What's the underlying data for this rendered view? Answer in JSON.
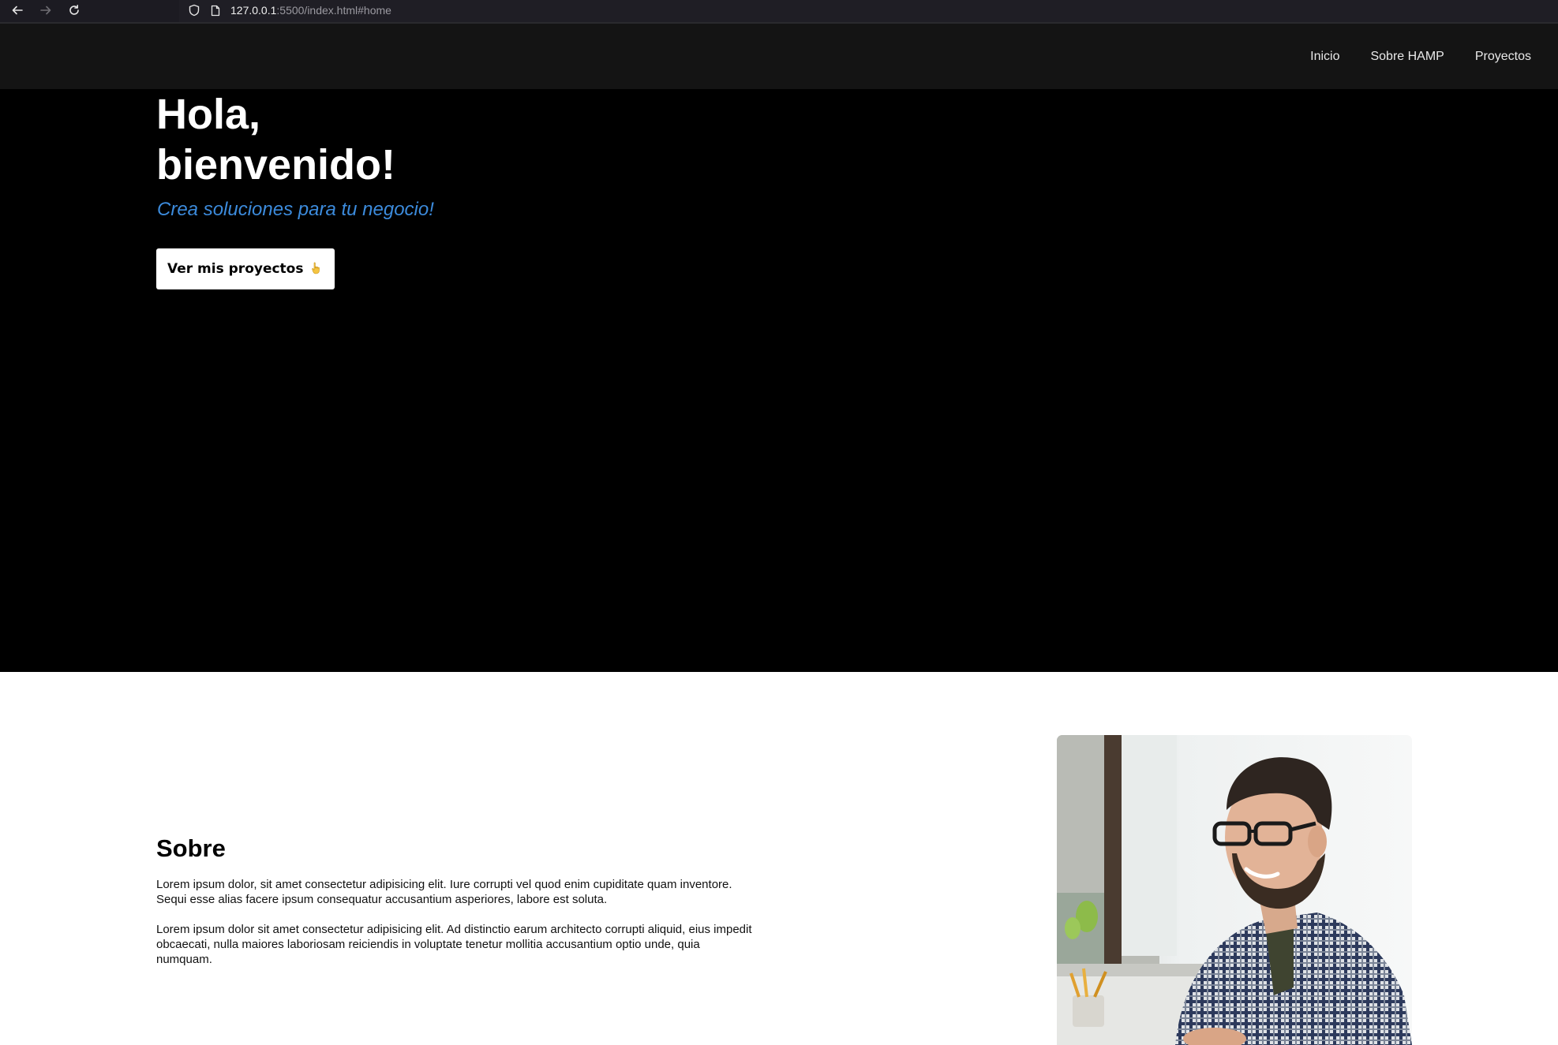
{
  "browser": {
    "url_host": "127.0.0.1",
    "url_rest": ":5500/index.html#home",
    "icons": [
      "back-arrow-icon",
      "forward-arrow-icon",
      "reload-icon",
      "shield-icon",
      "page-icon"
    ]
  },
  "nav": {
    "items": [
      {
        "label": "Inicio"
      },
      {
        "label": "Sobre HAMP"
      },
      {
        "label": "Proyectos"
      }
    ]
  },
  "hero": {
    "title_line1": "Hola,",
    "title_line2": "bienvenido!",
    "subtitle": "Crea soluciones para tu negocio!",
    "button_label": "Ver mis proyectos",
    "button_icon": "pointing-down-hand-icon"
  },
  "about": {
    "title": "Sobre",
    "paragraph1": "Lorem ipsum dolor, sit amet consectetur adipisicing elit. Iure corrupti vel quod enim cupiditate quam inventore. Sequi esse alias facere ipsum consequatur accusantium asperiores, labore est soluta.",
    "paragraph2": "Lorem ipsum dolor sit amet consectetur adipisicing elit. Ad distinctio earum architecto corrupti aliquid, eius impedit obcaecati, nulla maiores laboriosam reiciendis in voluptate tenetur mollitia accusantium optio unde, quia numquam."
  },
  "colors": {
    "header_bg": "#141414",
    "hero_bg": "#000000",
    "accent_blue": "#3c8bdc",
    "page_bg": "#ffffff"
  }
}
